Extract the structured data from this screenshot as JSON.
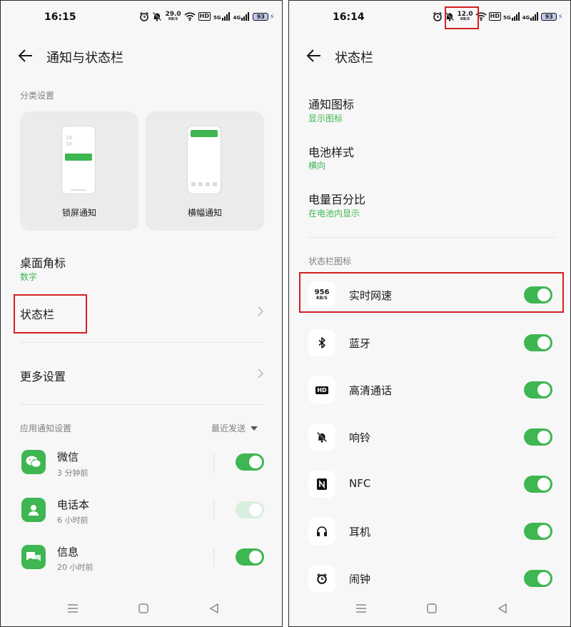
{
  "left": {
    "status_bar": {
      "time": "16:15",
      "speed_value": "29.0",
      "speed_unit": "KB/S",
      "hd": "HD",
      "sig1": "5G",
      "sig2": "4G",
      "battery": "93"
    },
    "header": {
      "title": "通知与状态栏"
    },
    "category_section": "分类设置",
    "cards": [
      {
        "label": "锁屏通知",
        "clock": "19\n30"
      },
      {
        "label": "横幅通知"
      }
    ],
    "desktop_badge": {
      "title": "桌面角标",
      "value": "数字"
    },
    "status_bar_item": {
      "title": "状态栏"
    },
    "more_settings": {
      "title": "更多设置"
    },
    "app_section": {
      "title": "应用通知设置",
      "sort": "最近发送"
    },
    "apps": [
      {
        "name": "微信",
        "time": "3 分钟前",
        "icon": "wechat-icon",
        "enabled": true
      },
      {
        "name": "电话本",
        "time": "6 小时前",
        "icon": "contacts-icon",
        "enabled": true
      },
      {
        "name": "信息",
        "time": "20 小时前",
        "icon": "messages-icon",
        "enabled": true
      }
    ]
  },
  "right": {
    "status_bar": {
      "time": "16:14",
      "speed_value": "12.0",
      "speed_unit": "KB/S",
      "hd": "HD",
      "sig1": "5G",
      "sig2": "4G",
      "battery": "93"
    },
    "header": {
      "title": "状态栏"
    },
    "settings": [
      {
        "title": "通知图标",
        "value": "显示图标"
      },
      {
        "title": "电池样式",
        "value": "横向"
      },
      {
        "title": "电量百分比",
        "value": "在电池内显示"
      }
    ],
    "icons_section": "状态栏图标",
    "speed_icon": {
      "value": "956",
      "unit": "KB/S"
    },
    "hd_icon_label": "HD",
    "nfc_icon_label": "N",
    "icon_toggles": [
      {
        "name": "实时网速",
        "icon": "network-speed-icon",
        "enabled": true
      },
      {
        "name": "蓝牙",
        "icon": "bluetooth-icon",
        "enabled": true
      },
      {
        "name": "高清通话",
        "icon": "hd-call-icon",
        "enabled": true
      },
      {
        "name": "响铃",
        "icon": "ringer-muted-icon",
        "enabled": true
      },
      {
        "name": "NFC",
        "icon": "nfc-icon",
        "enabled": true
      },
      {
        "name": "耳机",
        "icon": "headphones-icon",
        "enabled": true
      },
      {
        "name": "闹钟",
        "icon": "alarm-icon",
        "enabled": true
      }
    ]
  },
  "colors": {
    "accent": "#3eb651",
    "highlight_box": "#d32020",
    "background": "#f7f7f7",
    "secondary_text": "#808080"
  }
}
